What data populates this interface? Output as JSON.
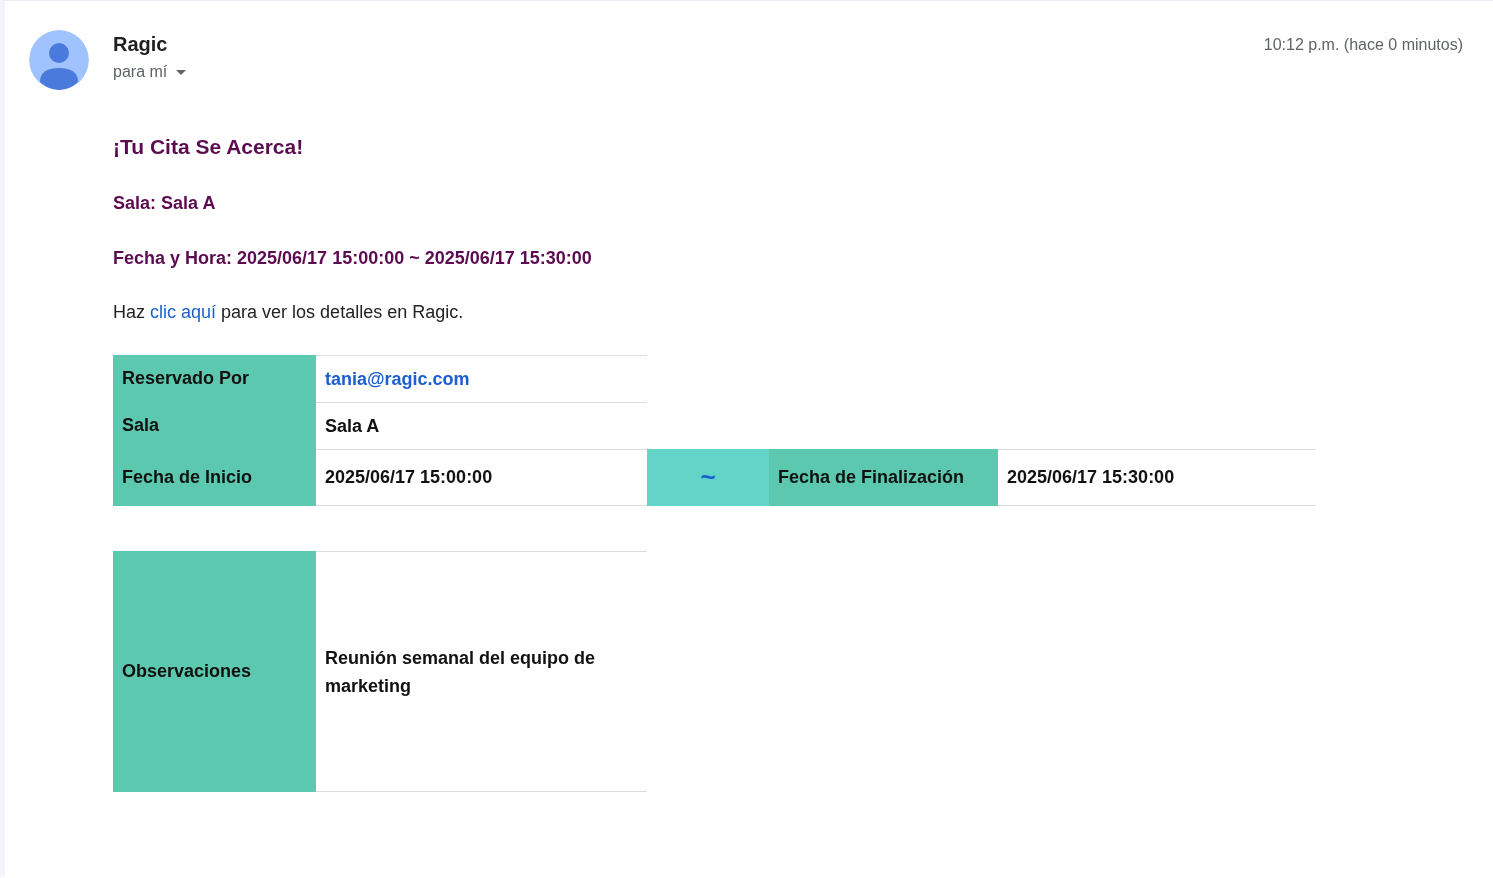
{
  "sender": {
    "name": "Ragic",
    "recipient": "para mí",
    "time": "10:12 p.m. (hace 0 minutos)"
  },
  "body": {
    "heading": "¡Tu Cita Se Acerca!",
    "lines": [
      "Sala: Sala A",
      "Fecha y Hora: 2025/06/17 15:00:00 ~ 2025/06/17 15:30:00"
    ],
    "intro": {
      "before": "Haz",
      "link": "clic aquí",
      "after": "para ver los detalles en Ragic."
    }
  },
  "details": [
    {
      "label": "Reservado Por",
      "value": "tania@ragic.com",
      "kind": "email"
    },
    {
      "label": "Sala",
      "value": "Sala A",
      "kind": "text"
    },
    {
      "label": "Fecha de Inicio",
      "value": "2025/06/17 15:00:00",
      "kind": "range",
      "separator": "~",
      "end_label": "Fecha de Finalización",
      "end_value": "2025/06/17 15:30:00"
    }
  ],
  "notes": {
    "label": "Observaciones",
    "value": "Reunión semanal del equipo de marketing"
  }
}
